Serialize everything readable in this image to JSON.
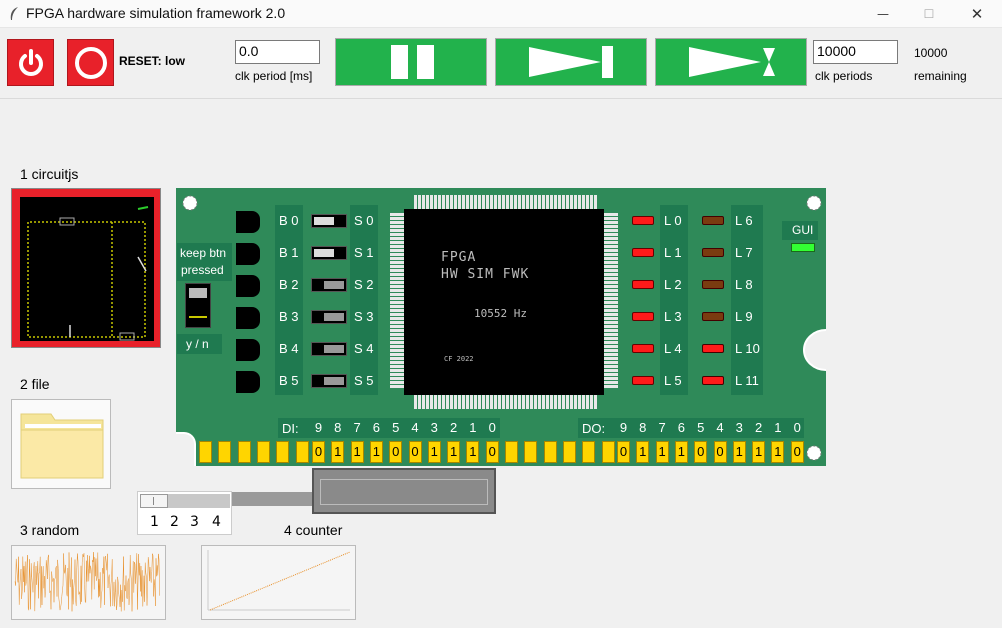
{
  "window": {
    "title": "FPGA hardware simulation framework 2.0",
    "min_glyph": "—",
    "max_glyph": "☐",
    "close_glyph": "✕"
  },
  "toolbar": {
    "reset_label": "RESET: low",
    "clk_period_value": "0.0",
    "clk_period_label": "clk period [ms]",
    "clk_periods_value": "10000",
    "clk_periods_label": "clk periods",
    "remaining_value": "10000",
    "remaining_label": "remaining",
    "icons": [
      "power-icon",
      "stop-icon",
      "pause-icon",
      "play-icon",
      "step-icon"
    ]
  },
  "sidebar": {
    "items": [
      {
        "label": "1  circuitjs",
        "icon": "circuit-thumbnail"
      },
      {
        "label": "2  file",
        "icon": "folder-icon"
      },
      {
        "label": "3  random",
        "icon": "random-plot-thumbnail"
      },
      {
        "label": "4  counter",
        "icon": "counter-plot-thumbnail"
      }
    ],
    "slider_labels": [
      "1",
      "2",
      "3",
      "4"
    ]
  },
  "board": {
    "keep_btn_line1": "keep btn",
    "keep_btn_line2": "pressed",
    "yn_label": "y / n",
    "buttons": [
      "B 0",
      "B 1",
      "B 2",
      "B 3",
      "B 4",
      "B 5"
    ],
    "switches": [
      "S 0",
      "S 1",
      "S 2",
      "S 3",
      "S 4",
      "S 5"
    ],
    "switch_states": [
      1,
      1,
      0,
      0,
      0,
      0
    ],
    "leds_left": [
      "L 0",
      "L 1",
      "L 2",
      "L 3",
      "L 4",
      "L 5"
    ],
    "leds_right": [
      "L 6",
      "L 7",
      "L 8",
      "L 9",
      "L 10",
      "L 11"
    ],
    "leds_left_state": [
      "on",
      "on",
      "on",
      "on",
      "on",
      "on"
    ],
    "leds_right_state": [
      "off",
      "off",
      "off",
      "off",
      "on",
      "on"
    ],
    "led_on_color": "#ff1a1a",
    "led_off_color": "#7a3b10",
    "gui_label": "GUI",
    "gui_led_color": "#33ff33",
    "chip": {
      "line1": "FPGA",
      "line2": "HW SIM FWK",
      "freq": "10552 Hz",
      "copyright": "CF 2022"
    },
    "di_label": "DI:",
    "do_label": "DO:",
    "bit_numbers": [
      "9",
      "8",
      "7",
      "6",
      "5",
      "4",
      "3",
      "2",
      "1",
      "0"
    ],
    "di_bits": [
      "0",
      "1",
      "1",
      "1",
      "0",
      "0",
      "1",
      "1",
      "1",
      "0"
    ],
    "do_bits": [
      "0",
      "1",
      "1",
      "1",
      "0",
      "0",
      "1",
      "1",
      "1",
      "0"
    ]
  },
  "colors": {
    "board_green": "#2f8a59",
    "toolbar_green": "#22b24c",
    "toolbar_red": "#e8212a",
    "bit_yellow": "#ffd500"
  }
}
